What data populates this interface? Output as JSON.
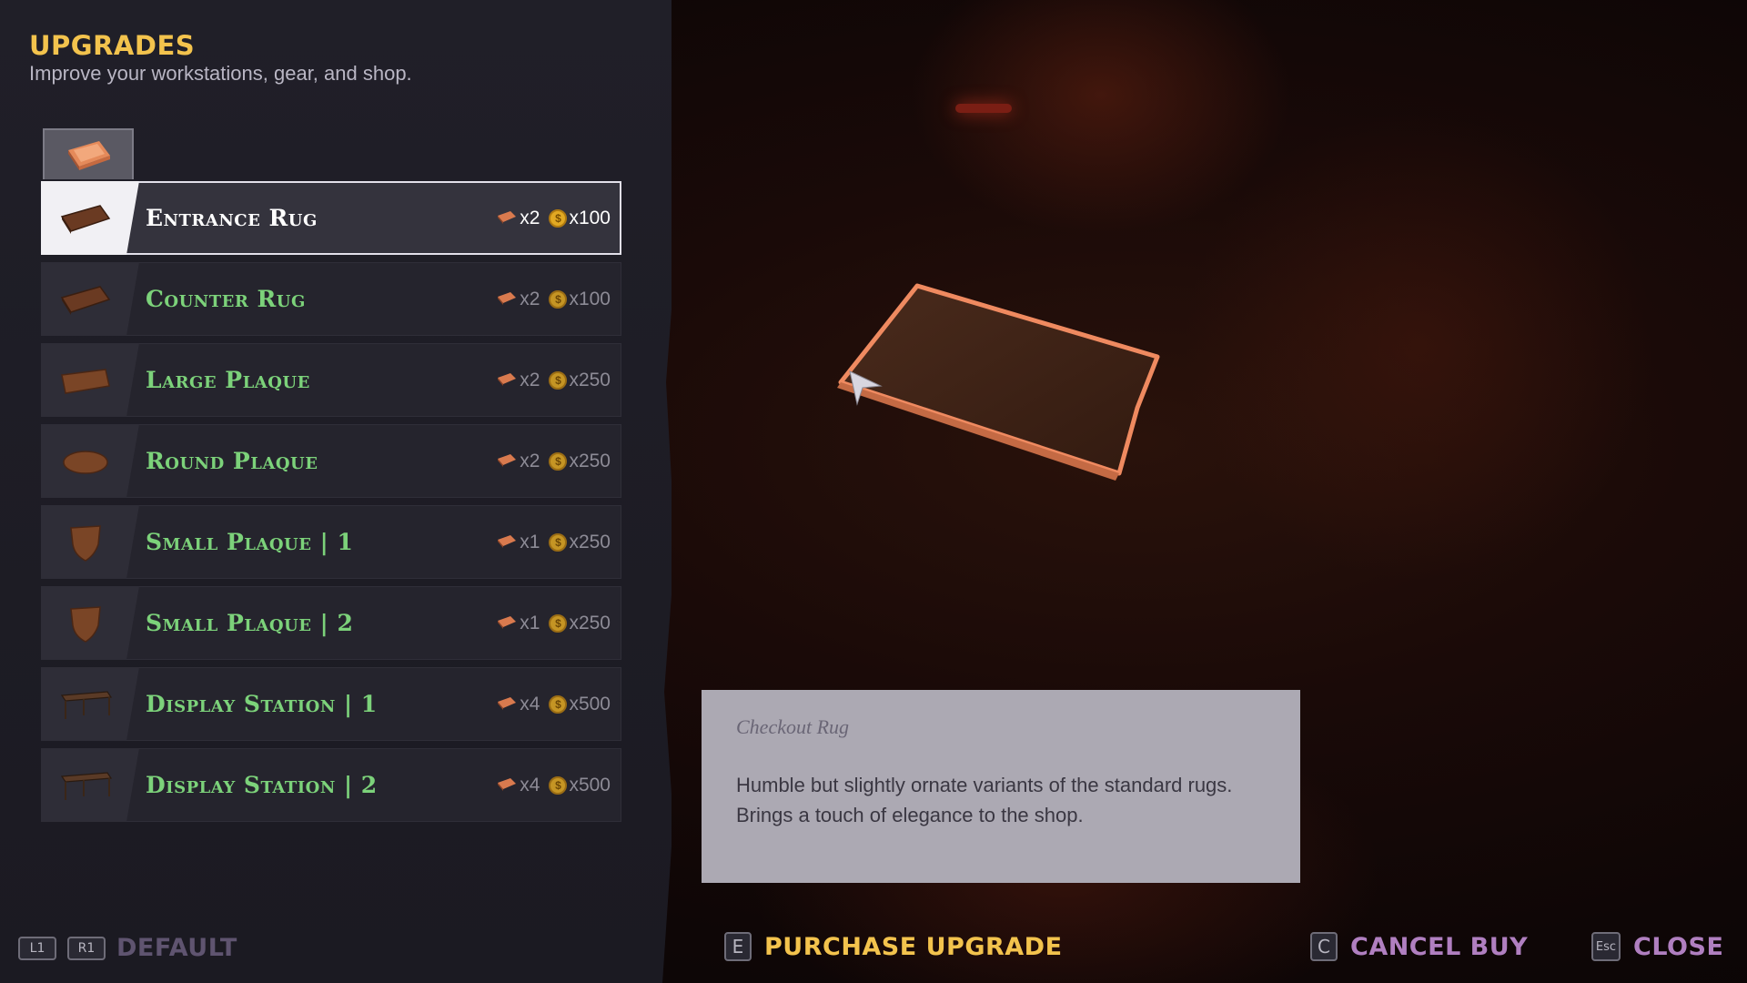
{
  "header": {
    "title": "UPGRADES",
    "subtitle": "Improve your workstations, gear, and shop."
  },
  "category_tab": {
    "icon": "ingot-icon",
    "selected": true
  },
  "items": [
    {
      "name": "Entrance Rug",
      "icon": "rug-icon",
      "material_qty": "x2",
      "coin_qty": "x100",
      "selected": true
    },
    {
      "name": "Counter Rug",
      "icon": "rug-icon",
      "material_qty": "x2",
      "coin_qty": "x100",
      "selected": false
    },
    {
      "name": "Large Plaque",
      "icon": "plaque-icon",
      "material_qty": "x2",
      "coin_qty": "x250",
      "selected": false
    },
    {
      "name": "Round Plaque",
      "icon": "round-plaque-icon",
      "material_qty": "x2",
      "coin_qty": "x250",
      "selected": false
    },
    {
      "name": "Small Plaque | 1",
      "icon": "shield-plaque-icon",
      "material_qty": "x1",
      "coin_qty": "x250",
      "selected": false
    },
    {
      "name": "Small Plaque | 2",
      "icon": "shield-plaque-icon",
      "material_qty": "x1",
      "coin_qty": "x250",
      "selected": false
    },
    {
      "name": "Display Station | 1",
      "icon": "table-icon",
      "material_qty": "x4",
      "coin_qty": "x500",
      "selected": false
    },
    {
      "name": "Display Station | 2",
      "icon": "table-icon",
      "material_qty": "x4",
      "coin_qty": "x500",
      "selected": false
    }
  ],
  "description": {
    "title": "Checkout Rug",
    "body": "Humble but slightly ornate variants of the standard rugs. Brings a touch of elegance to the shop."
  },
  "footer": {
    "default": {
      "keys": [
        "L1",
        "R1"
      ],
      "label": "DEFAULT"
    },
    "purchase": {
      "key": "E",
      "label": "PURCHASE UPGRADE"
    },
    "cancel": {
      "key": "C",
      "label": "CANCEL BUY"
    },
    "close": {
      "key": "Esc",
      "label": "CLOSE"
    }
  },
  "colors": {
    "title": "#f3c34d",
    "item_name": "#7cd27a",
    "purchase_label": "#f3c34d",
    "cancel_close_label": "#b07fc0",
    "default_label": "#5f5470"
  }
}
